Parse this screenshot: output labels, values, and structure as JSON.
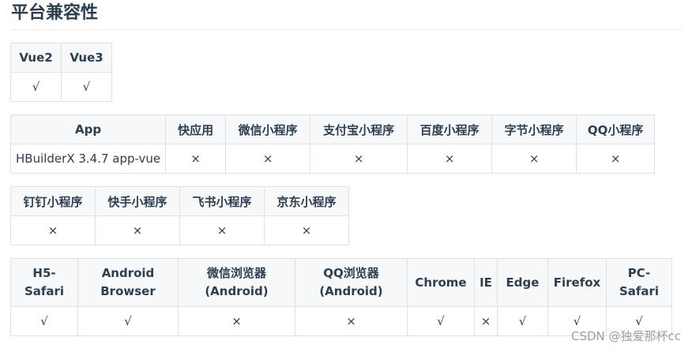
{
  "title": "平台兼容性",
  "vue_table": {
    "headers": [
      "Vue2",
      "Vue3"
    ],
    "row": [
      "√",
      "√"
    ]
  },
  "app_table": {
    "headers": [
      "App",
      "快应用",
      "微信小程序",
      "支付宝小程序",
      "百度小程序",
      "字节小程序",
      "QQ小程序"
    ],
    "row": [
      "HBuilderX 3.4.7 app-vue",
      "×",
      "×",
      "×",
      "×",
      "×",
      "×"
    ]
  },
  "mini_table": {
    "headers": [
      "钉钉小程序",
      "快手小程序",
      "飞书小程序",
      "京东小程序"
    ],
    "row": [
      "×",
      "×",
      "×",
      "×"
    ]
  },
  "browser_table": {
    "headers": [
      "H5-Safari",
      "Android Browser",
      "微信浏览器(Android)",
      "QQ浏览器(Android)",
      "Chrome",
      "IE",
      "Edge",
      "Firefox",
      "PC-Safari"
    ],
    "row": [
      "√",
      "√",
      "×",
      "×",
      "√",
      "×",
      "√",
      "√",
      "√"
    ]
  },
  "watermark": "CSDN @独爱那杯cc"
}
